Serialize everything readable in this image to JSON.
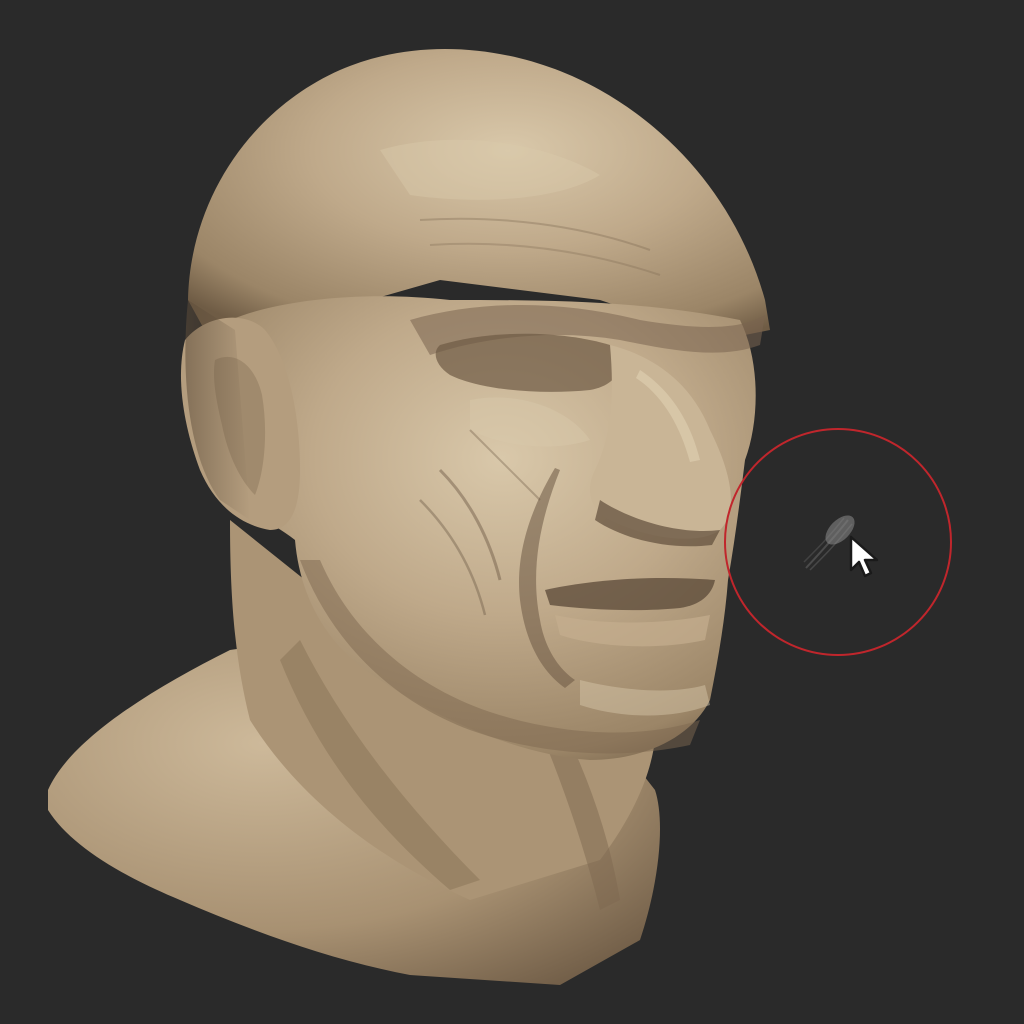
{
  "viewport": {
    "background_color": "#2a2a2a",
    "model": {
      "kind": "sculpted-head-bust",
      "material_color": "#b8a386",
      "shadow_color": "#6e5d48",
      "highlight_color": "#d6c5a8"
    },
    "brush": {
      "ring_color": "#c0262c",
      "stroke_preview_color": "#8a8a8a"
    },
    "cursor": {
      "icon": "arrow-pointer-icon",
      "fill_color": "#ffffff",
      "outline_color": "#1a1a1a"
    }
  }
}
